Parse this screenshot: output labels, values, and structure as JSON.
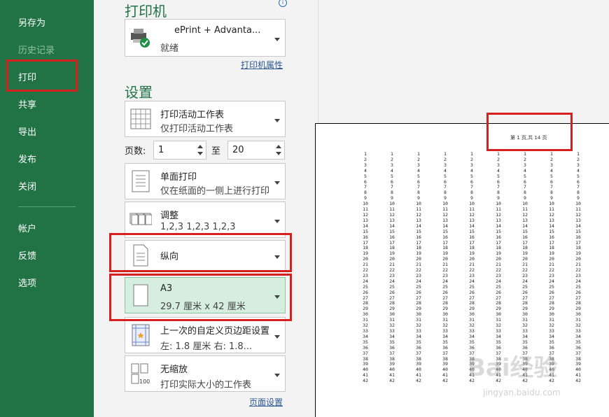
{
  "sidebar": {
    "items": [
      "另存为",
      "历史记录",
      "打印",
      "共享",
      "导出",
      "发布",
      "关闭"
    ],
    "bottom_items": [
      "帐户",
      "反馈",
      "选项"
    ],
    "active": "打印",
    "disabled": "历史记录"
  },
  "printer": {
    "section_title": "打印机",
    "name": "ePrint + Advanta...",
    "status": "就绪",
    "properties_link": "打印机属性"
  },
  "settings": {
    "section_title": "设置",
    "scope": {
      "title": "打印活动工作表",
      "subtitle": "仅打印活动工作表"
    },
    "pages_label": "页数:",
    "pages_from": "1",
    "pages_to_label": "至",
    "pages_to": "20",
    "sides": {
      "title": "单面打印",
      "subtitle": "仅在纸面的一侧上进行打印"
    },
    "collate": {
      "title": "调整",
      "subtitle": "1,2,3    1,2,3    1,2,3"
    },
    "orientation": {
      "title": "纵向"
    },
    "paper": {
      "title": "A3",
      "subtitle": "29.7 厘米 x 42 厘米"
    },
    "margins": {
      "title": "上一次的自定义页边距设置",
      "subtitle": "左: 1.8 厘米    右: 1.8..."
    },
    "scaling": {
      "title": "无缩放",
      "subtitle": "打印实际大小的工作表"
    },
    "page_setup_link": "页面设置"
  },
  "preview": {
    "header": "第 1 页,共 14 页",
    "rows": 42,
    "columns": 9
  },
  "watermark": "Bai经验",
  "watermark_url": "jingyan.baidu.com",
  "colors": {
    "accent": "#217346",
    "highlight": "#d61f1f",
    "selected": "#d5eedf"
  }
}
